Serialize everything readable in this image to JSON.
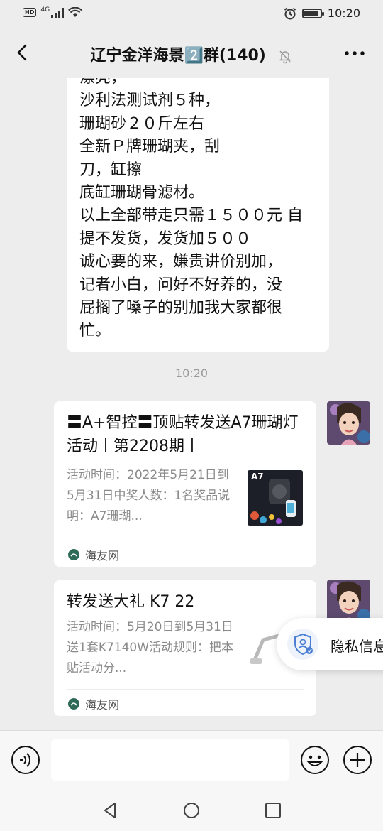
{
  "status_bar": {
    "left_badge": "HD",
    "network": "4G",
    "time": "10:20",
    "battery_level": 0.85
  },
  "header": {
    "title": "辽宁金洋海景2️⃣群(140)",
    "back_icon": "chevron-left-icon",
    "mute_icon": "bell-off-icon",
    "more_icon": "more-dots-icon"
  },
  "messages": [
    {
      "type": "text",
      "sender": "other",
      "text": "漂亮，\n沙利法测试剂５种，\n珊瑚砂２０斤左右\n全新Ｐ牌珊瑚夹，刮\n刀，缸擦\n底缸珊瑚骨滤材。\n以上全部带走只需１５００元 自\n提不发货，发货加５００\n诚心要的来，嫌贵讲价别加，\n记者小白，问好不好养的，没\n屁搁了嗓子的别加我大家都很\n忙。"
    },
    {
      "type": "timestamp",
      "text": "10:20"
    },
    {
      "type": "link_card",
      "sender": "self",
      "title": "〓A+智控〓顶贴转发送A7珊瑚灯活动丨第2208期丨",
      "description": "活动时间：2022年5月21日到5月31日中奖人数：1名奖品说明：A7珊瑚...",
      "thumbnail_label": "A7",
      "source": "海友网"
    },
    {
      "type": "link_card",
      "sender": "self",
      "title": "转发送大礼 K7 22",
      "description": "活动时间：5月20日到5月31日送1套K7140W活动规则：把本贴活动分...",
      "source": "海友网"
    }
  ],
  "privacy_popup": {
    "label": "隐私信息",
    "icon": "shield-user-icon"
  },
  "input_bar": {
    "voice_icon": "voice-icon",
    "emoji_icon": "emoji-icon",
    "plus_icon": "plus-circle-icon",
    "placeholder": ""
  },
  "system_nav": {
    "back_icon": "triangle-back-icon",
    "home_icon": "circle-home-icon",
    "recent_icon": "square-recent-icon"
  }
}
